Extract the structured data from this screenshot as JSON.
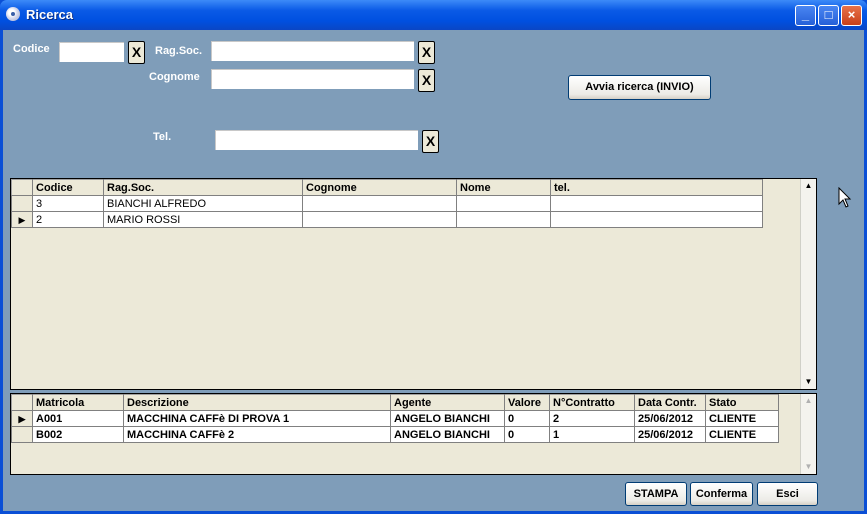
{
  "window": {
    "title": "Ricerca",
    "minimize_glyph": "_",
    "maximize_glyph": "□",
    "close_glyph": "×"
  },
  "form": {
    "codice_label": "Codice",
    "codice_value": "",
    "ragsoc_label": "Rag.Soc.",
    "ragsoc_value": "",
    "cognome_label": "Cognome",
    "cognome_value": "",
    "tel_label": "Tel.",
    "tel_value": "",
    "clear_glyph": "X",
    "search_button": "Avvia ricerca (INVIO)"
  },
  "clients_grid": {
    "columns": [
      "Codice",
      "Rag.Soc.",
      "Cognome",
      "Nome",
      "tel."
    ],
    "rows": [
      {
        "codice": "3",
        "ragsoc": "BIANCHI ALFREDO",
        "cognome": "",
        "nome": "",
        "tel": ""
      },
      {
        "codice": "2",
        "ragsoc": "MARIO ROSSI",
        "cognome": "",
        "nome": "",
        "tel": ""
      }
    ]
  },
  "machines_grid": {
    "columns": [
      "Matricola",
      "Descrizione",
      "Agente",
      "Valore",
      "N°Contratto",
      "Data Contr.",
      "Stato"
    ],
    "rows": [
      {
        "matricola": "A001",
        "descrizione": "MACCHINA CAFFè DI PROVA 1",
        "agente": "ANGELO BIANCHI",
        "valore": "0",
        "contratto": "2",
        "data": "25/06/2012",
        "stato": "CLIENTE"
      },
      {
        "matricola": "B002",
        "descrizione": "MACCHINA CAFFè 2",
        "agente": "ANGELO BIANCHI",
        "valore": "0",
        "contratto": "1",
        "data": "25/06/2012",
        "stato": "CLIENTE"
      }
    ]
  },
  "footer": {
    "stampa": "STAMPA",
    "conferma": "Conferma",
    "esci": "Esci"
  },
  "icons": {
    "row_pointer": "▶",
    "scroll_up": "▲",
    "scroll_down": "▼"
  }
}
